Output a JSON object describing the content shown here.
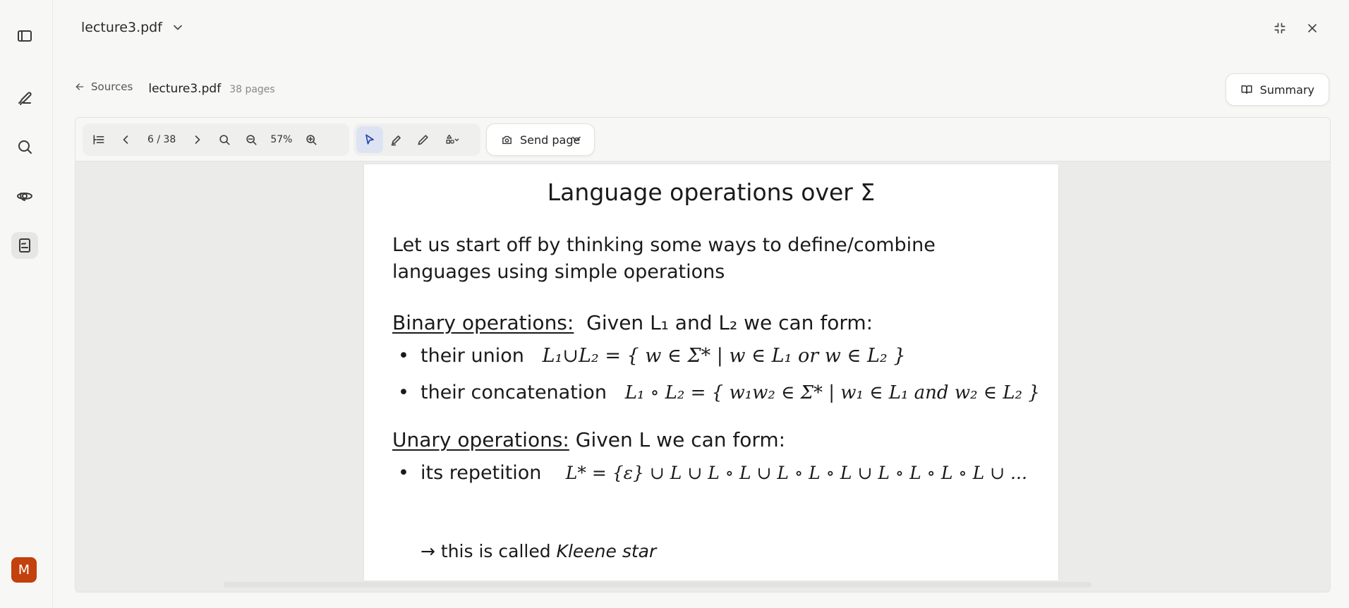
{
  "rail": {
    "avatar_letter": "M",
    "icons": [
      "sidebar-toggle-icon",
      "pen-icon",
      "search-icon",
      "orbit-icon",
      "document-icon"
    ]
  },
  "header": {
    "title": "lecture3.pdf"
  },
  "breadcrumb": {
    "back_label": "Sources",
    "file_name": "lecture3.pdf",
    "page_count": "38 pages"
  },
  "summary_label": "Summary",
  "toolbar": {
    "page_indicator": "6 / 38",
    "zoom": "57%",
    "send_label": "Send page"
  },
  "slide": {
    "title": "Language operations over Σ",
    "intro_line1": "Let us start off by thinking some ways to define/combine",
    "intro_line2": "languages using simple operations",
    "binary_heading": "Binary operations:",
    "binary_rest": "Given L₁ and L₂ we can form:",
    "union_label": "their union",
    "union_formula": "L₁∪L₂ = { w ∈ Σ* | w ∈ L₁ or w ∈ L₂ }",
    "concat_label": "their concatenation",
    "concat_formula": "L₁ ∘ L₂ = { w₁w₂ ∈ Σ* | w₁ ∈ L₁ and w₂ ∈ L₂ }",
    "unary_heading": "Unary operations:",
    "unary_rest": "Given L we can form:",
    "rep_label": "its repetition",
    "rep_formula": "L* = {ε} ∪ L ∪ L ∘ L ∪ L ∘ L ∘ L ∪ L ∘ L ∘ L ∘ L ∪ ...",
    "note_prefix": "→ this is called",
    "note_italic": "Kleene star"
  }
}
